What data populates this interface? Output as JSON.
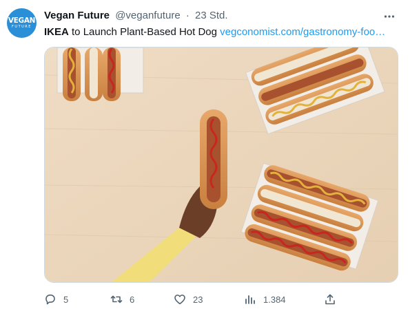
{
  "tweet": {
    "avatar_text": "VEGAN",
    "avatar_subtext": "FUTURE",
    "display_name": "Vegan Future",
    "handle": "@veganfuture",
    "separator": "·",
    "time": "23 Std.",
    "text_brand": "IKEA",
    "text_body": " to Launch Plant-Based Hot Dog ",
    "link_text": "vegconomist.com/gastronomy-foo…",
    "media_icon": "photo-hot-dogs",
    "metrics": {
      "replies": "5",
      "retweets": "6",
      "likes": "23",
      "views": "1.384"
    },
    "colors": {
      "link": "#1d9bf0",
      "secondary_text": "#536471",
      "avatar": "#2a8fd6"
    }
  }
}
